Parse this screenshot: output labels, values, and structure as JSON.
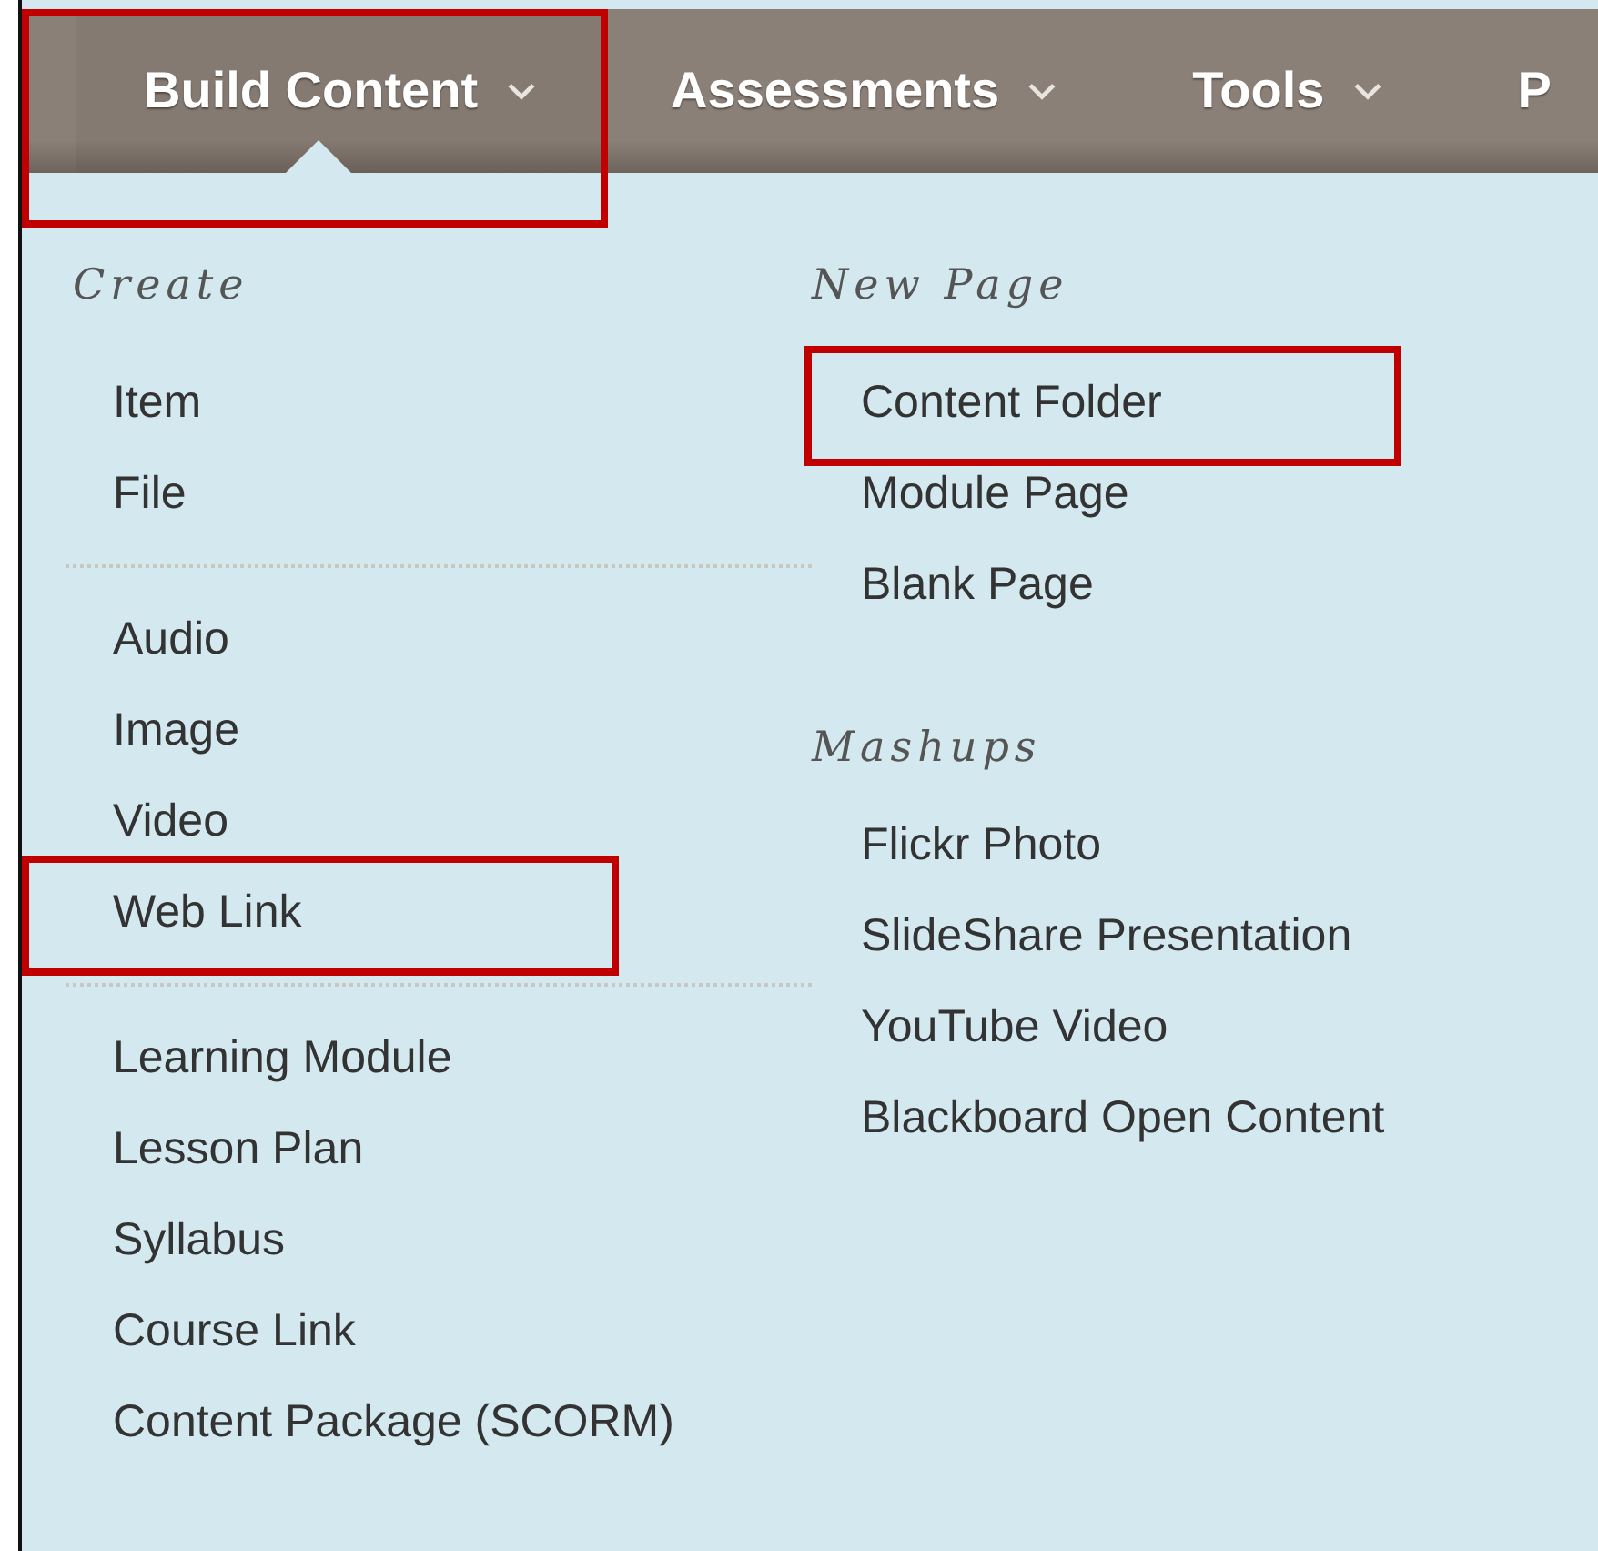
{
  "nav": {
    "tabs": [
      {
        "label": "Build Content",
        "selected": true,
        "highlighted": true
      },
      {
        "label": "Assessments",
        "selected": false,
        "highlighted": false
      },
      {
        "label": "Tools",
        "selected": false,
        "highlighted": false
      },
      {
        "label": "P",
        "selected": false,
        "highlighted": false
      }
    ]
  },
  "menu": {
    "columns": [
      {
        "sections": [
          {
            "heading": "Create",
            "groups": [
              [
                {
                  "label": "Item",
                  "highlighted": false
                },
                {
                  "label": "File",
                  "highlighted": false
                }
              ],
              [
                {
                  "label": "Audio",
                  "highlighted": false
                },
                {
                  "label": "Image",
                  "highlighted": false
                },
                {
                  "label": "Video",
                  "highlighted": false
                },
                {
                  "label": "Web Link",
                  "highlighted": true
                }
              ],
              [
                {
                  "label": "Learning Module",
                  "highlighted": false
                },
                {
                  "label": "Lesson Plan",
                  "highlighted": false
                },
                {
                  "label": "Syllabus",
                  "highlighted": false
                },
                {
                  "label": "Course Link",
                  "highlighted": false
                },
                {
                  "label": "Content Package (SCORM)",
                  "highlighted": false
                }
              ]
            ]
          }
        ]
      },
      {
        "sections": [
          {
            "heading": "New Page",
            "groups": [
              [
                {
                  "label": "Content Folder",
                  "highlighted": true
                },
                {
                  "label": "Module Page",
                  "highlighted": false
                },
                {
                  "label": "Blank Page",
                  "highlighted": false
                }
              ]
            ]
          },
          {
            "heading": "Mashups",
            "groups": [
              [
                {
                  "label": "Flickr Photo",
                  "highlighted": false
                },
                {
                  "label": "SlideShare Presentation",
                  "highlighted": false
                },
                {
                  "label": "YouTube Video",
                  "highlighted": false
                },
                {
                  "label": "Blackboard Open Content",
                  "highlighted": false
                }
              ]
            ]
          }
        ]
      }
    ]
  }
}
